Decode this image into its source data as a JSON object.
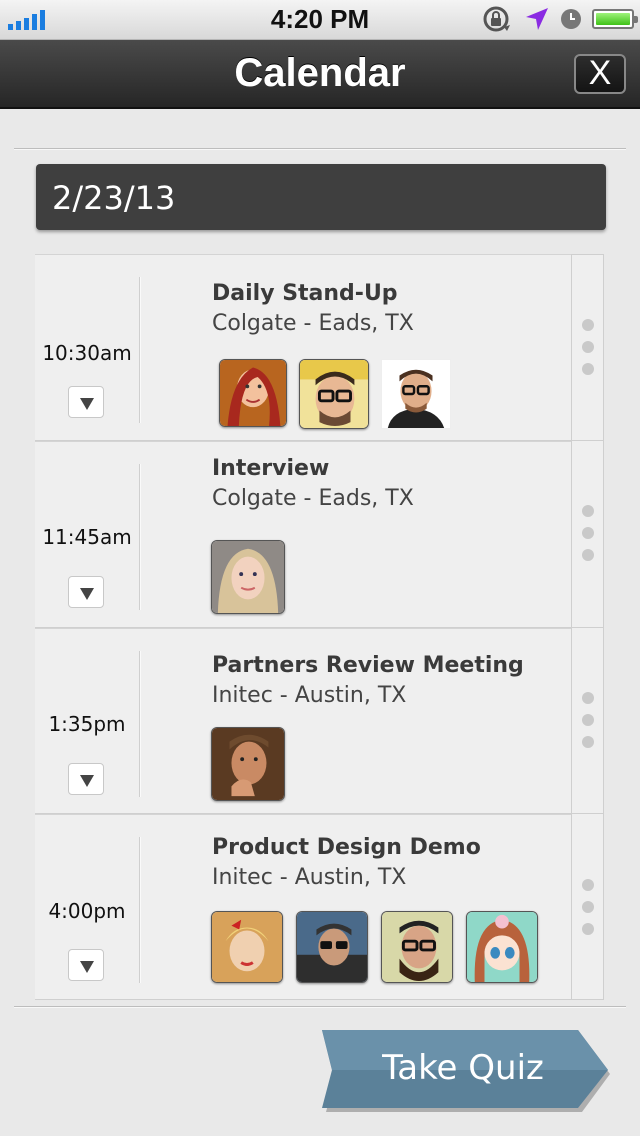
{
  "status_bar": {
    "time": "4:20 PM"
  },
  "nav": {
    "title": "Calendar",
    "close_label": "X"
  },
  "date": "2/23/13",
  "events": [
    {
      "time": "10:30am",
      "title": "Daily Stand-Up",
      "location": "Colgate - Eads, TX",
      "attendee_count": 3
    },
    {
      "time": "11:45am",
      "title": "Interview",
      "location": "Colgate - Eads, TX",
      "attendee_count": 1
    },
    {
      "time": "1:35pm",
      "title": "Partners Review Meeting",
      "location": "Initec - Austin, TX",
      "attendee_count": 1
    },
    {
      "time": "4:00pm",
      "title": "Product Design Demo",
      "location": "Initec - Austin, TX",
      "attendee_count": 4
    }
  ],
  "quiz_button": {
    "label": "Take Quiz"
  },
  "colors": {
    "nav_bar": "#2e2e2e",
    "date_bar": "#3f3f3f",
    "quiz_button": "#5b8199",
    "background": "#e9e9e9"
  }
}
